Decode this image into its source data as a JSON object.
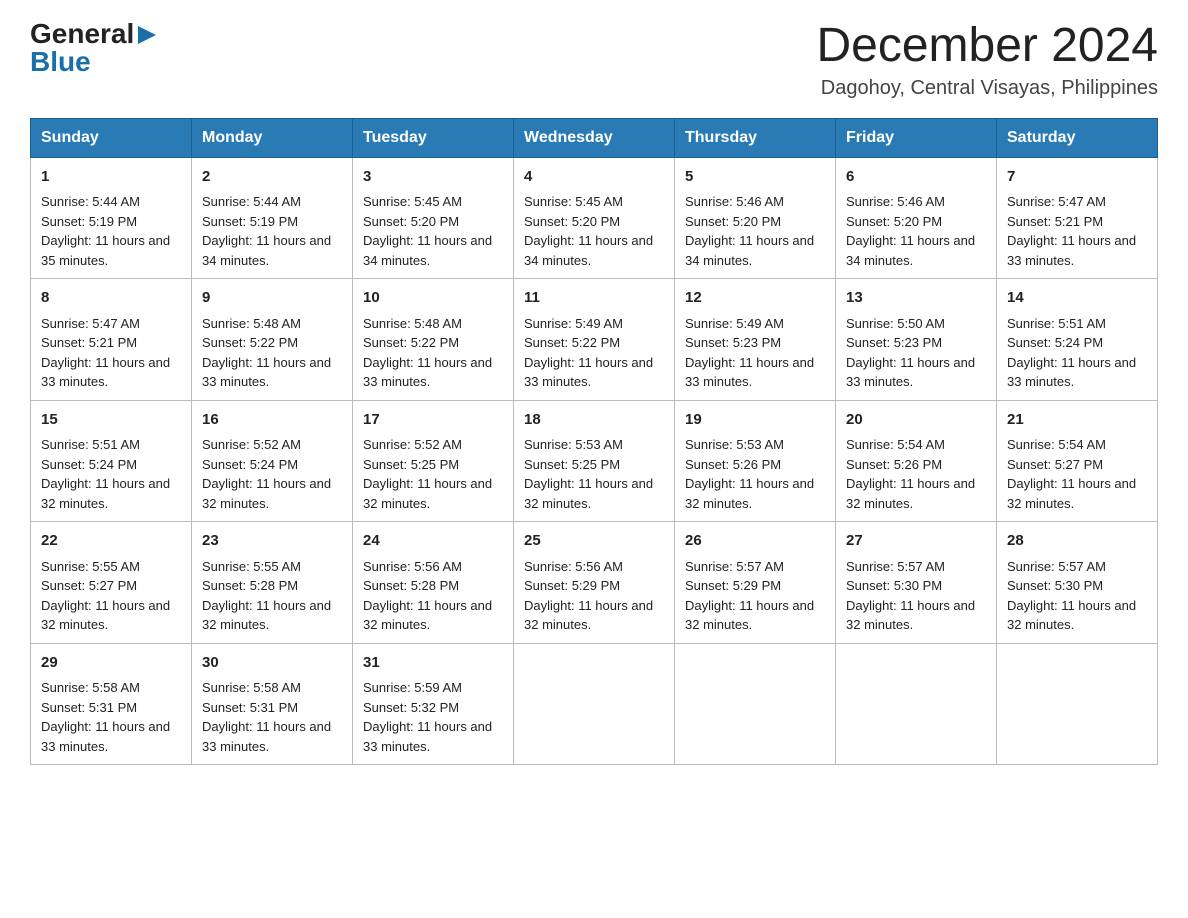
{
  "header": {
    "logo": {
      "general": "General",
      "blue": "Blue",
      "arrow": "▶"
    },
    "month_year": "December 2024",
    "location": "Dagohoy, Central Visayas, Philippines"
  },
  "calendar": {
    "days_of_week": [
      "Sunday",
      "Monday",
      "Tuesday",
      "Wednesday",
      "Thursday",
      "Friday",
      "Saturday"
    ],
    "weeks": [
      [
        {
          "day": 1,
          "sunrise": "5:44 AM",
          "sunset": "5:19 PM",
          "daylight": "11 hours and 35 minutes."
        },
        {
          "day": 2,
          "sunrise": "5:44 AM",
          "sunset": "5:19 PM",
          "daylight": "11 hours and 34 minutes."
        },
        {
          "day": 3,
          "sunrise": "5:45 AM",
          "sunset": "5:20 PM",
          "daylight": "11 hours and 34 minutes."
        },
        {
          "day": 4,
          "sunrise": "5:45 AM",
          "sunset": "5:20 PM",
          "daylight": "11 hours and 34 minutes."
        },
        {
          "day": 5,
          "sunrise": "5:46 AM",
          "sunset": "5:20 PM",
          "daylight": "11 hours and 34 minutes."
        },
        {
          "day": 6,
          "sunrise": "5:46 AM",
          "sunset": "5:20 PM",
          "daylight": "11 hours and 34 minutes."
        },
        {
          "day": 7,
          "sunrise": "5:47 AM",
          "sunset": "5:21 PM",
          "daylight": "11 hours and 33 minutes."
        }
      ],
      [
        {
          "day": 8,
          "sunrise": "5:47 AM",
          "sunset": "5:21 PM",
          "daylight": "11 hours and 33 minutes."
        },
        {
          "day": 9,
          "sunrise": "5:48 AM",
          "sunset": "5:22 PM",
          "daylight": "11 hours and 33 minutes."
        },
        {
          "day": 10,
          "sunrise": "5:48 AM",
          "sunset": "5:22 PM",
          "daylight": "11 hours and 33 minutes."
        },
        {
          "day": 11,
          "sunrise": "5:49 AM",
          "sunset": "5:22 PM",
          "daylight": "11 hours and 33 minutes."
        },
        {
          "day": 12,
          "sunrise": "5:49 AM",
          "sunset": "5:23 PM",
          "daylight": "11 hours and 33 minutes."
        },
        {
          "day": 13,
          "sunrise": "5:50 AM",
          "sunset": "5:23 PM",
          "daylight": "11 hours and 33 minutes."
        },
        {
          "day": 14,
          "sunrise": "5:51 AM",
          "sunset": "5:24 PM",
          "daylight": "11 hours and 33 minutes."
        }
      ],
      [
        {
          "day": 15,
          "sunrise": "5:51 AM",
          "sunset": "5:24 PM",
          "daylight": "11 hours and 32 minutes."
        },
        {
          "day": 16,
          "sunrise": "5:52 AM",
          "sunset": "5:24 PM",
          "daylight": "11 hours and 32 minutes."
        },
        {
          "day": 17,
          "sunrise": "5:52 AM",
          "sunset": "5:25 PM",
          "daylight": "11 hours and 32 minutes."
        },
        {
          "day": 18,
          "sunrise": "5:53 AM",
          "sunset": "5:25 PM",
          "daylight": "11 hours and 32 minutes."
        },
        {
          "day": 19,
          "sunrise": "5:53 AM",
          "sunset": "5:26 PM",
          "daylight": "11 hours and 32 minutes."
        },
        {
          "day": 20,
          "sunrise": "5:54 AM",
          "sunset": "5:26 PM",
          "daylight": "11 hours and 32 minutes."
        },
        {
          "day": 21,
          "sunrise": "5:54 AM",
          "sunset": "5:27 PM",
          "daylight": "11 hours and 32 minutes."
        }
      ],
      [
        {
          "day": 22,
          "sunrise": "5:55 AM",
          "sunset": "5:27 PM",
          "daylight": "11 hours and 32 minutes."
        },
        {
          "day": 23,
          "sunrise": "5:55 AM",
          "sunset": "5:28 PM",
          "daylight": "11 hours and 32 minutes."
        },
        {
          "day": 24,
          "sunrise": "5:56 AM",
          "sunset": "5:28 PM",
          "daylight": "11 hours and 32 minutes."
        },
        {
          "day": 25,
          "sunrise": "5:56 AM",
          "sunset": "5:29 PM",
          "daylight": "11 hours and 32 minutes."
        },
        {
          "day": 26,
          "sunrise": "5:57 AM",
          "sunset": "5:29 PM",
          "daylight": "11 hours and 32 minutes."
        },
        {
          "day": 27,
          "sunrise": "5:57 AM",
          "sunset": "5:30 PM",
          "daylight": "11 hours and 32 minutes."
        },
        {
          "day": 28,
          "sunrise": "5:57 AM",
          "sunset": "5:30 PM",
          "daylight": "11 hours and 32 minutes."
        }
      ],
      [
        {
          "day": 29,
          "sunrise": "5:58 AM",
          "sunset": "5:31 PM",
          "daylight": "11 hours and 33 minutes."
        },
        {
          "day": 30,
          "sunrise": "5:58 AM",
          "sunset": "5:31 PM",
          "daylight": "11 hours and 33 minutes."
        },
        {
          "day": 31,
          "sunrise": "5:59 AM",
          "sunset": "5:32 PM",
          "daylight": "11 hours and 33 minutes."
        },
        null,
        null,
        null,
        null
      ]
    ]
  }
}
